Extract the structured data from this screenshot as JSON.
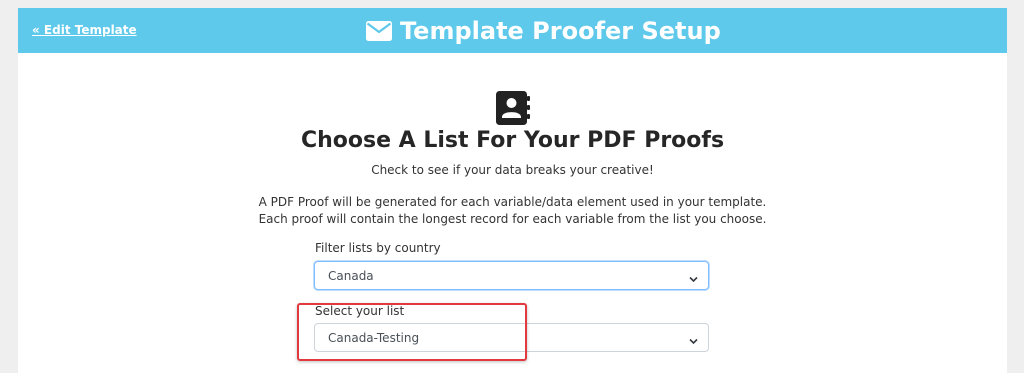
{
  "header": {
    "back_link": "« Edit Template",
    "title": "Template Proofer Setup",
    "title_icon": "envelope-icon",
    "color": "#5ec9ea"
  },
  "main": {
    "icon": "contact-book-icon",
    "heading": "Choose A List For Your PDF Proofs",
    "subtitle": "Check to see if your data breaks your creative!",
    "description_line1": "A PDF Proof will be generated for each variable/data element used in your template.",
    "description_line2": "Each proof will contain the longest record for each variable from the list you choose."
  },
  "filter": {
    "label": "Filter lists by country",
    "selected": "Canada"
  },
  "list_select": {
    "label": "Select your list",
    "selected": "Canada-Testing"
  },
  "highlight_color": "#e03a3e"
}
